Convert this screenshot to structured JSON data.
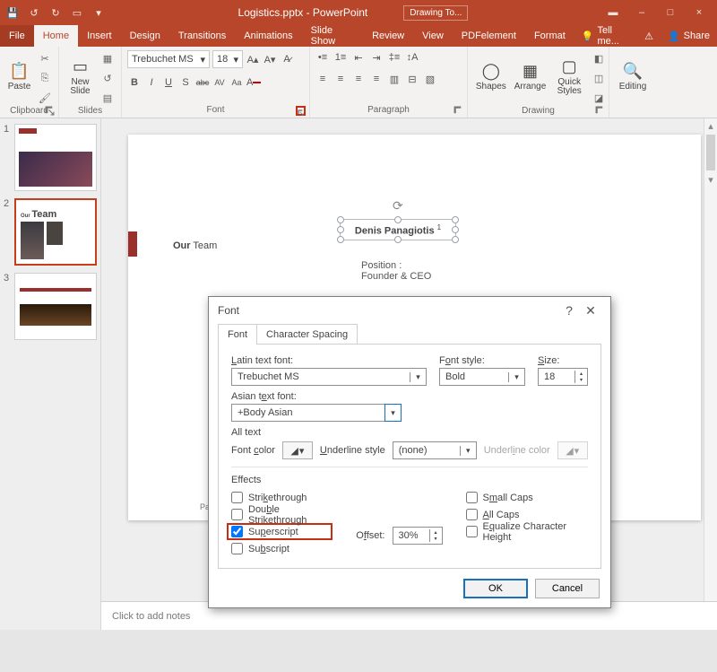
{
  "titlebar": {
    "filename": "Logistics.pptx - PowerPoint",
    "contextual_tab": "Drawing To..."
  },
  "window_buttons": {
    "help": "?",
    "min": "–",
    "max": "□",
    "close": "×"
  },
  "tabs": {
    "file": "File",
    "home": "Home",
    "insert": "Insert",
    "design": "Design",
    "transitions": "Transitions",
    "animations": "Animations",
    "slideshow": "Slide Show",
    "review": "Review",
    "view": "View",
    "pdfelement": "PDFelement",
    "format": "Format",
    "tellme": "Tell me...",
    "share": "Share"
  },
  "ribbon": {
    "clipboard": {
      "paste": "Paste",
      "name": "Clipboard"
    },
    "slides": {
      "newslide": "New\nSlide",
      "name": "Slides"
    },
    "font": {
      "name_dd": "Trebuchet MS",
      "size_dd": "18",
      "name": "Font",
      "bold": "B",
      "italic": "I",
      "underline": "U",
      "strike": "S",
      "shadow": "abc",
      "charspace": "AV",
      "case": "Aa",
      "clear": "A"
    },
    "paragraph": {
      "name": "Paragraph"
    },
    "drawing": {
      "shapes": "Shapes",
      "arrange": "Arrange",
      "quickstyles": "Quick\nStyles",
      "name": "Drawing"
    },
    "editing": {
      "editing": "Editing"
    }
  },
  "slide_content": {
    "our": "Our",
    "team": " Team",
    "name": "Denis Panagiotis",
    "sup": "1",
    "position_label": "Position :",
    "position_value": "Founder & CEO",
    "page": "Page : 2"
  },
  "notes_placeholder": "Click to add notes",
  "dialog": {
    "title": "Font",
    "tabs": {
      "font": "Font",
      "spacing": "Character Spacing"
    },
    "latin_label": "Latin text font:",
    "latin_value": "Trebuchet MS",
    "style_label": "Font style:",
    "style_value": "Bold",
    "size_label": "Size:",
    "size_value": "18",
    "asian_label": "Asian text font:",
    "asian_value": "+Body Asian",
    "alltext_label": "All text",
    "fontcolor_label": "Font color",
    "underline_label": "Underline style",
    "underline_value": "(none)",
    "ulinecolor_label": "Underline color",
    "effects_label": "Effects",
    "strike": "Strikethrough",
    "dblstrike": "Double Strikethrough",
    "superscript": "Superscript",
    "subscript": "Subscript",
    "smallcaps": "Small Caps",
    "allcaps": "All Caps",
    "equalize": "Equalize Character Height",
    "offset_label": "Offset:",
    "offset_value": "30%",
    "ok": "OK",
    "cancel": "Cancel",
    "help": "?",
    "close": "✕"
  },
  "chart_data": null
}
